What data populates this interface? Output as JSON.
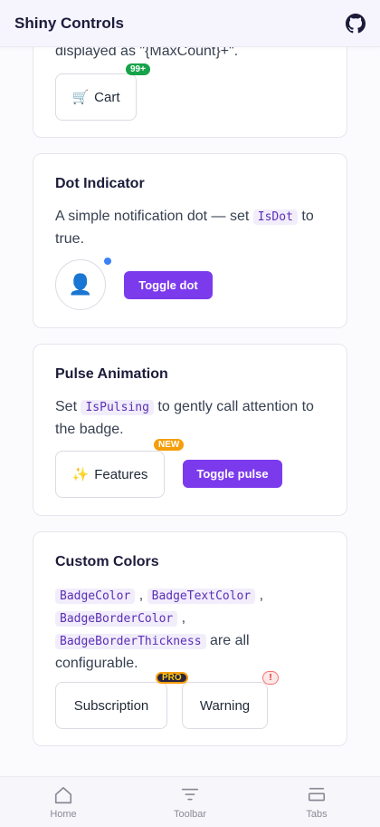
{
  "app": {
    "title": "Shiny Controls",
    "github_icon": "github-icon"
  },
  "max_count_card": {
    "desc_tail": "displayed as \"{MaxCount}+\".",
    "cart_icon": "🛒",
    "cart_label": "Cart",
    "badge": "99+",
    "badge_color": "#16a34a"
  },
  "dot_card": {
    "title": "Dot Indicator",
    "desc_pre": "A simple notification dot — set ",
    "desc_code": "IsDot",
    "desc_post": " to true.",
    "avatar_icon": "👤",
    "toggle_label": "Toggle dot",
    "dot_color": "#3b82f6"
  },
  "pulse_card": {
    "title": "Pulse Animation",
    "desc_pre": "Set ",
    "desc_code": "IsPulsing",
    "desc_post": " to gently call attention to the badge.",
    "features_icon": "✨",
    "features_label": "Features",
    "badge": "NEW",
    "badge_color": "#f59e0b",
    "toggle_label": "Toggle pulse"
  },
  "colors_card": {
    "title": "Custom Colors",
    "code1": "BadgeColor",
    "sep1": " , ",
    "code2": "BadgeTextColor",
    "sep2": " ,",
    "code3": "BadgeBorderColor",
    "sep3": " ,",
    "code4": "BadgeBorderThickness",
    "desc_post": " are all configurable.",
    "subscription_label": "Subscription",
    "pro_badge": "PRO",
    "warning_label": "Warning",
    "warning_badge": "!"
  },
  "tabs": [
    {
      "label": "Home",
      "icon": "home-icon"
    },
    {
      "label": "Toolbar",
      "icon": "toolbar-icon"
    },
    {
      "label": "Tabs",
      "icon": "tabs-icon"
    }
  ],
  "colors": {
    "accent": "#7c3aed",
    "text": "#1c1b3a"
  }
}
